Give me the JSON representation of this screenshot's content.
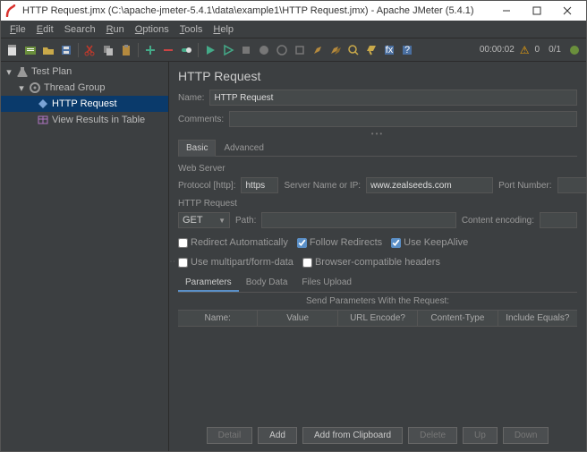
{
  "window": {
    "title": "HTTP Request.jmx (C:\\apache-jmeter-5.4.1\\data\\example1\\HTTP Request.jmx) - Apache JMeter (5.4.1)"
  },
  "menu": {
    "file": "File",
    "edit": "Edit",
    "search": "Search",
    "run": "Run",
    "options": "Options",
    "tools": "Tools",
    "help": "Help"
  },
  "status": {
    "timer": "00:00:02",
    "warn_count": "0",
    "thread_count": "0/1"
  },
  "tree": {
    "test_plan": "Test Plan",
    "thread_group": "Thread Group",
    "http_request": "HTTP Request",
    "view_results": "View Results in Table"
  },
  "panel": {
    "title": "HTTP Request",
    "name_label": "Name:",
    "name_value": "HTTP Request",
    "comments_label": "Comments:",
    "comments_value": "",
    "tabs": {
      "basic": "Basic",
      "advanced": "Advanced"
    },
    "web_server": {
      "title": "Web Server",
      "protocol_label": "Protocol [http]:",
      "protocol_value": "https",
      "server_label": "Server Name or IP:",
      "server_value": "www.zealseeds.com",
      "port_label": "Port Number:",
      "port_value": ""
    },
    "http_request": {
      "title": "HTTP Request",
      "method": "GET",
      "path_label": "Path:",
      "path_value": "",
      "encoding_label": "Content encoding:",
      "encoding_value": ""
    },
    "checks": {
      "redirect_auto": "Redirect Automatically",
      "follow_redirects": "Follow Redirects",
      "keepalive": "Use KeepAlive",
      "multipart": "Use multipart/form-data",
      "browser_headers": "Browser-compatible headers"
    },
    "subtabs": {
      "parameters": "Parameters",
      "body_data": "Body Data",
      "files_upload": "Files Upload"
    },
    "table": {
      "caption": "Send Parameters With the Request:",
      "cols": {
        "name": "Name:",
        "value": "Value",
        "url_encode": "URL Encode?",
        "content_type": "Content-Type",
        "include_equals": "Include Equals?"
      }
    },
    "buttons": {
      "detail": "Detail",
      "add": "Add",
      "add_clipboard": "Add from Clipboard",
      "delete": "Delete",
      "up": "Up",
      "down": "Down"
    }
  }
}
